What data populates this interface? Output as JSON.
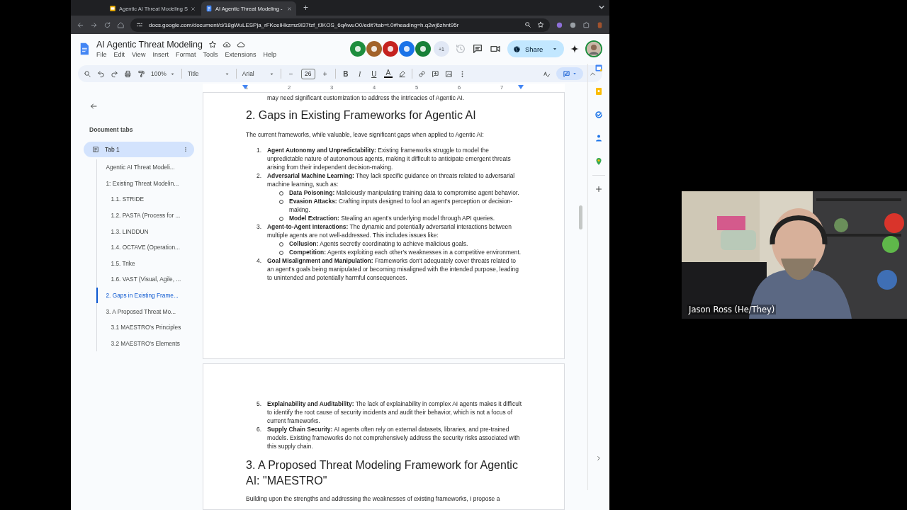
{
  "browser": {
    "tabs": [
      {
        "title": "Agentic AI Threat Modeling S",
        "kind": "slides",
        "selected": false
      },
      {
        "title": "AI Agentic Threat Modeling -",
        "kind": "docs",
        "selected": true
      }
    ],
    "new_tab": "+",
    "url": "docs.google.com/document/d/18gWuLESPja_rFKcelHkzmz9l37fzf_fJKOS_6qAwuO0/edit?tab=t.0#heading=h.q2wj6zhnt95r"
  },
  "docs": {
    "title": "AI Agentic Threat Modeling",
    "menu": [
      "File",
      "Edit",
      "View",
      "Insert",
      "Format",
      "Tools",
      "Extensions",
      "Help"
    ],
    "collaborators": [
      {
        "color": "#1e8e3e"
      },
      {
        "color": "#a2632a"
      },
      {
        "color": "#c5221f"
      },
      {
        "color": "#1a73e8"
      },
      {
        "color": "#188038"
      }
    ],
    "more_collaborators": "+1",
    "share": "Share",
    "toolbar": {
      "zoom": "100%",
      "style": "Title",
      "font": "Arial",
      "size_minus": "−",
      "font_size": "26",
      "size_plus": "+",
      "format": [
        "B",
        "I",
        "U",
        "A"
      ]
    }
  },
  "sidebar": {
    "heading": "Document tabs",
    "tabs": [
      {
        "label": "Tab 1",
        "selected": true,
        "outline": [
          {
            "label": "Agentic AI Threat Modeli...",
            "selected": false
          },
          {
            "label": "1: Existing Threat Modelin...",
            "selected": false,
            "children": [
              {
                "label": "1.1. STRIDE",
                "selected": false
              },
              {
                "label": "1.2. PASTA (Process for ...",
                "selected": false
              },
              {
                "label": "1.3. LINDDUN",
                "selected": false
              },
              {
                "label": "1.4. OCTAVE (Operation...",
                "selected": false
              },
              {
                "label": "1.5. Trike",
                "selected": false
              },
              {
                "label": "1.6. VAST (Visual, Agile, ...",
                "selected": false
              }
            ]
          },
          {
            "label": "2. Gaps in Existing Frame...",
            "selected": true
          },
          {
            "label": "3. A Proposed Threat Mo...",
            "selected": false,
            "children": [
              {
                "label": "3.1 MAESTRO's Principles",
                "selected": false
              },
              {
                "label": "3.2 MAESTRO's Elements",
                "selected": false
              }
            ]
          }
        ]
      }
    ]
  },
  "ruler": [
    "1",
    "2",
    "3",
    "4",
    "5",
    "6",
    "7"
  ],
  "pages": [
    {
      "blocks": [
        {
          "kind": "paragraph",
          "text": "may need significant customization to address the intricacies of Agentic AI."
        },
        {
          "kind": "heading",
          "text": "2. Gaps in Existing Frameworks for Agentic AI"
        },
        {
          "kind": "paragraph",
          "text": "The current frameworks, while valuable, leave significant gaps when applied to Agentic AI:"
        },
        {
          "kind": "numbered",
          "number": "1.",
          "text": "**Agent Autonomy and Unpredictability:** Existing frameworks struggle to model the unpredictable nature of autonomous agents, making it difficult to anticipate emergent threats arising from their independent decision-making."
        },
        {
          "kind": "numbered",
          "number": "2.",
          "text": "**Adversarial Machine Learning:** They lack specific guidance on threats related to adversarial machine learning, such as:",
          "children": [
            {
              "text": "**Data Poisoning:** Maliciously manipulating training data to compromise agent behavior."
            },
            {
              "text": "**Evasion Attacks:** Crafting inputs designed to fool an agent's perception or decision-making."
            },
            {
              "text": "**Model Extraction:** Stealing an agent's underlying model through API queries."
            }
          ]
        },
        {
          "kind": "numbered",
          "number": "3.",
          "text": "**Agent-to-Agent Interactions:** The dynamic and potentially adversarial interactions between multiple agents are not well-addressed. This includes issues like:",
          "children": [
            {
              "text": "**Collusion:** Agents secretly coordinating to achieve malicious goals."
            },
            {
              "text": "**Competition:** Agents exploiting each other's weaknesses in a competitive environment."
            }
          ]
        },
        {
          "kind": "numbered",
          "number": "4.",
          "text": "**Goal Misalignment and Manipulation:** Frameworks don't adequately cover threats related to an agent's goals being manipulated or becoming misaligned with the intended purpose, leading to unintended and potentially harmful consequences."
        }
      ]
    },
    {
      "blocks": [
        {
          "kind": "numbered",
          "number": "5.",
          "text": "**Explainability and Auditability:** The lack of explainability in complex AI agents makes it difficult to identify the root cause of security incidents and audit their behavior, which is not a focus of current frameworks."
        },
        {
          "kind": "numbered",
          "number": "6.",
          "text": "**Supply Chain Security:** AI agents often rely on external datasets, libraries, and pre-trained models. Existing frameworks do not comprehensively address the security risks associated with this supply chain."
        },
        {
          "kind": "heading",
          "text": "3. A Proposed Threat Modeling Framework for Agentic AI: \"MAESTRO\""
        },
        {
          "kind": "paragraph",
          "text": "Building upon the strengths and addressing the weaknesses of existing frameworks, I propose a"
        }
      ]
    }
  ],
  "video": {
    "name": "Jason Ross (He/They)"
  }
}
